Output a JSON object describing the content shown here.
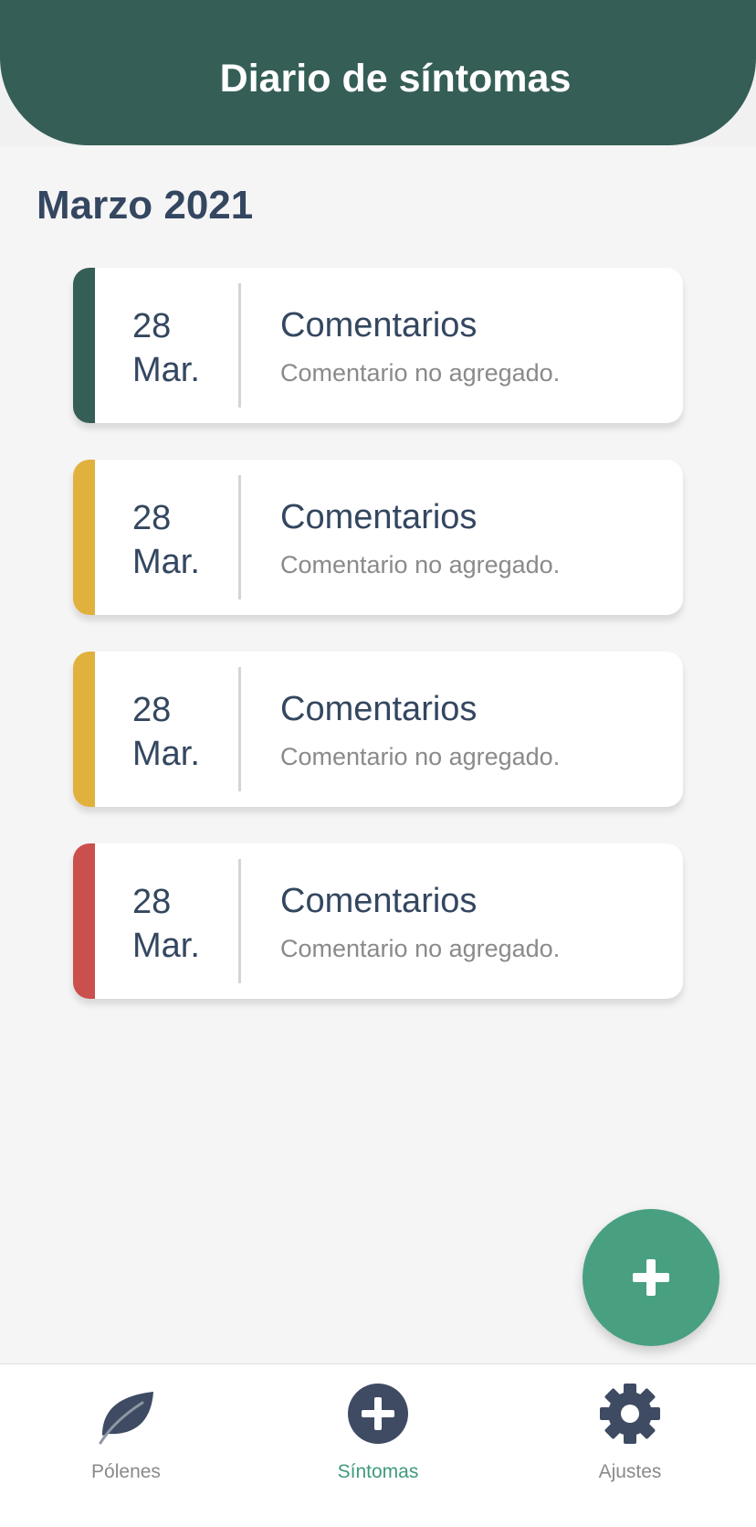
{
  "header": {
    "title": "Diario de síntomas"
  },
  "month": "Marzo 2021",
  "entries": [
    {
      "day": "28",
      "month": "Mar.",
      "title": "Comentarios",
      "comment": "Comentario no agregado.",
      "color": "#355e56"
    },
    {
      "day": "28",
      "month": "Mar.",
      "title": "Comentarios",
      "comment": "Comentario no agregado.",
      "color": "#e1b13e"
    },
    {
      "day": "28",
      "month": "Mar.",
      "title": "Comentarios",
      "comment": "Comentario no agregado.",
      "color": "#e1b13e"
    },
    {
      "day": "28",
      "month": "Mar.",
      "title": "Comentarios",
      "comment": "Comentario no agregado.",
      "color": "#ca504e"
    }
  ],
  "fab": {
    "icon": "plus-icon"
  },
  "tabbar": {
    "tabs": [
      {
        "label": "Pólenes",
        "icon": "leaf-icon",
        "active": false
      },
      {
        "label": "Síntomas",
        "icon": "plus-circle-icon",
        "active": true
      },
      {
        "label": "Ajustes",
        "icon": "gear-icon",
        "active": false
      }
    ]
  },
  "colors": {
    "primary": "#355e56",
    "accent": "#48a081",
    "text": "#344760",
    "muted": "#8a8a8a"
  }
}
